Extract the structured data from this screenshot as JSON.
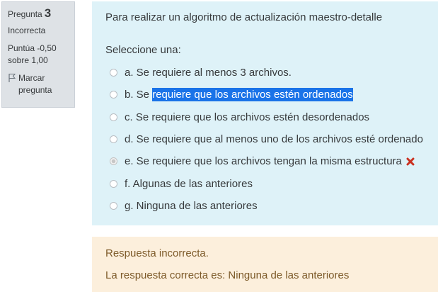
{
  "info": {
    "question_label": "Pregunta",
    "question_number": "3",
    "state": "Incorrecta",
    "grade_line1": "Puntúa -0,50",
    "grade_line2": "sobre 1,00",
    "flag_line1": "Marcar",
    "flag_line2": "pregunta"
  },
  "question": {
    "text": "Para realizar un algoritmo de actualización maestro-detalle",
    "prompt": "Seleccione una:",
    "options": [
      {
        "label": "a. Se requiere al menos 3 archivos.",
        "checked": false
      },
      {
        "label_pre": "b. Se ",
        "label_hl": "requiere que los archivos estén ordenados",
        "checked": false
      },
      {
        "label": "c. Se requiere que los archivos estén desordenados",
        "checked": false
      },
      {
        "label": "d. Se requiere que al menos uno de los archivos esté ordenado",
        "checked": false
      },
      {
        "label": "e. Se requiere que los archivos tengan la misma estructura",
        "checked": true
      },
      {
        "label": "f. Algunas de las anteriores",
        "checked": false
      },
      {
        "label": "g. Ninguna de las anteriores",
        "checked": false
      }
    ],
    "wrong_icon": "close-x-icon",
    "wrong_color": "#ca3120",
    "highlight_color": "#1a73e8"
  },
  "feedback": {
    "result": "Respuesta incorrecta.",
    "correct_answer": "La respuesta correcta es: Ninguna de las anteriores"
  }
}
